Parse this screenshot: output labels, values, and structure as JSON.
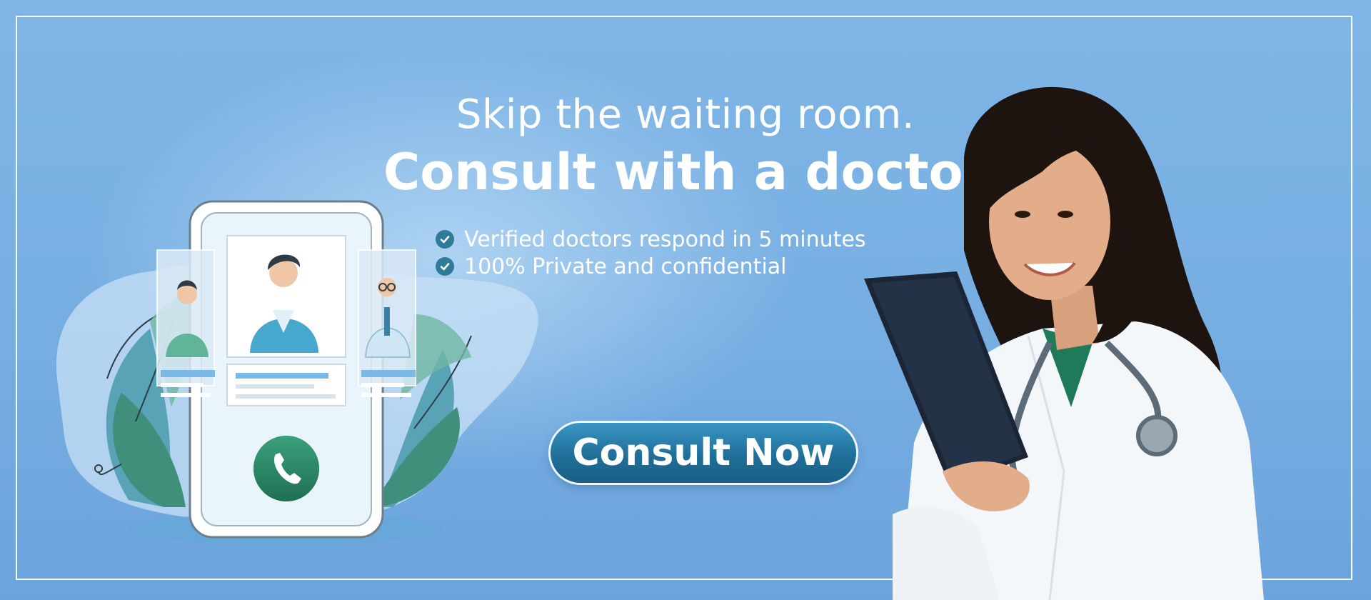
{
  "banner": {
    "headline_line1": "Skip the waiting room.",
    "headline_line2": "Consult with a doctor",
    "features": [
      "Verified doctors respond in 5 minutes",
      "100% Private and confidential"
    ],
    "cta_label": "Consult Now"
  },
  "colors": {
    "background": "#79b0e3",
    "text": "#ffffff",
    "button": "#1f6f98",
    "check": "#2f7c9a",
    "call_button": "#2c8a66"
  },
  "icons": [
    "check-icon",
    "phone-icon"
  ]
}
